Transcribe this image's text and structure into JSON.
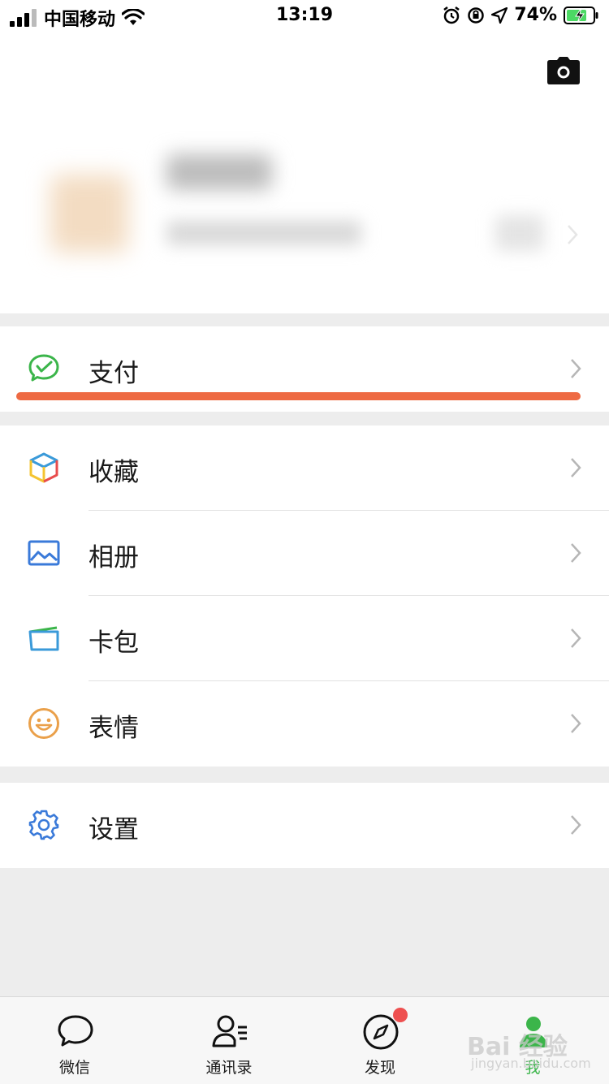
{
  "status_bar": {
    "carrier": "中国移动",
    "time": "13:19",
    "battery": "74%"
  },
  "menu": {
    "pay": {
      "label": "支付",
      "icon": "wechat-pay-icon",
      "color": "#3bb54a"
    },
    "favorites": {
      "label": "收藏",
      "icon": "cube-icon"
    },
    "album": {
      "label": "相册",
      "icon": "photo-icon",
      "color": "#3a7ad9"
    },
    "cards": {
      "label": "卡包",
      "icon": "card-icon"
    },
    "stickers": {
      "label": "表情",
      "icon": "smile-icon",
      "color": "#eaa04a"
    },
    "settings": {
      "label": "设置",
      "icon": "gear-icon",
      "color": "#3a7ad9"
    }
  },
  "highlight_color": "#ee6a43",
  "tabs": [
    {
      "label": "微信",
      "icon": "chat-bubble-icon"
    },
    {
      "label": "通讯录",
      "icon": "contacts-icon"
    },
    {
      "label": "发现",
      "icon": "compass-icon"
    },
    {
      "label": "我",
      "icon": "person-icon",
      "active": true
    }
  ],
  "watermark": {
    "text": "Bai 经验",
    "sub": "jingyan.baidu.com"
  }
}
